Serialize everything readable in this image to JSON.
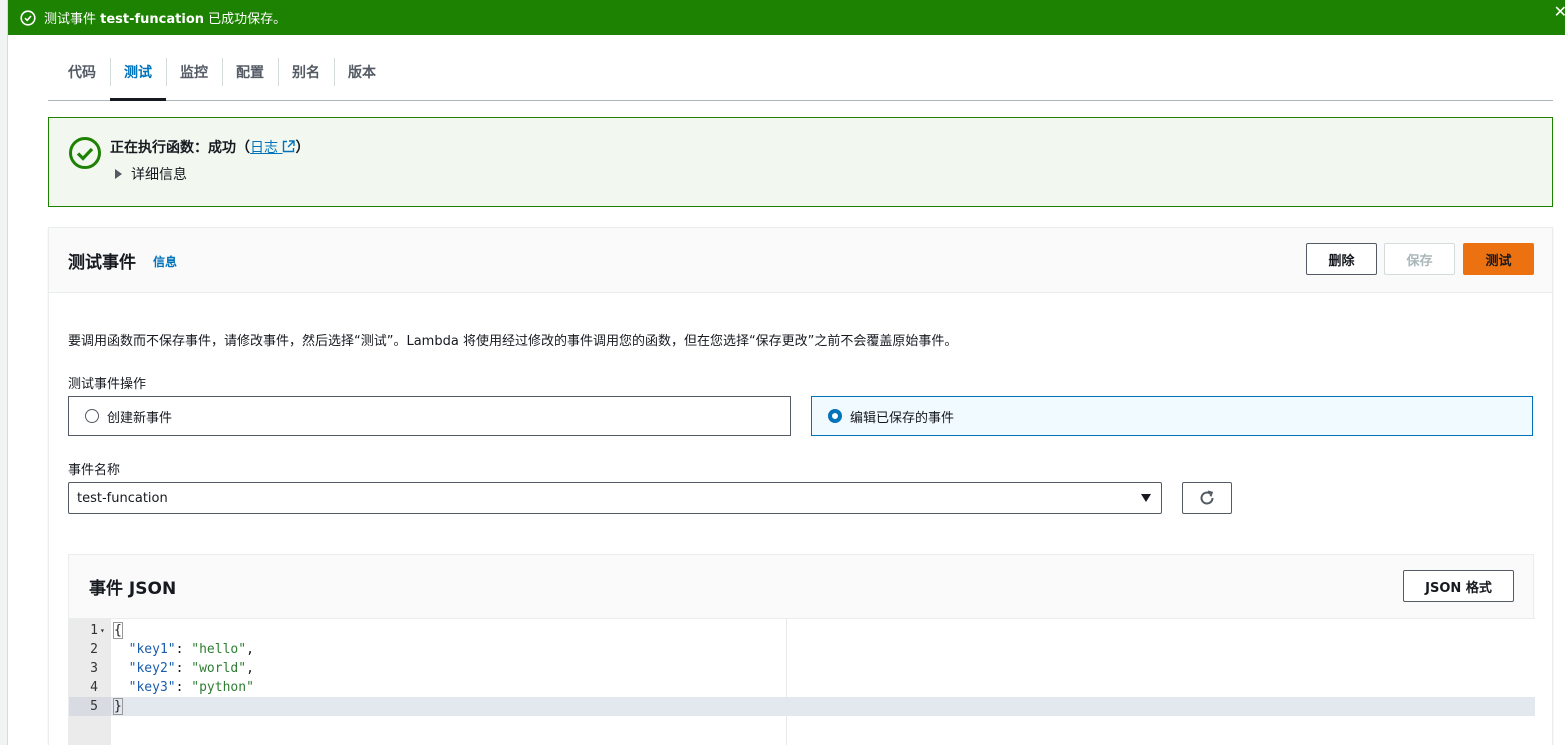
{
  "flash": {
    "prefix": "测试事件 ",
    "name": "test-funcation",
    "suffix": " 已成功保存。",
    "close_glyph": "✕"
  },
  "tabs": [
    {
      "label": "代码",
      "active": false
    },
    {
      "label": "测试",
      "active": true
    },
    {
      "label": "监控",
      "active": false
    },
    {
      "label": "配置",
      "active": false
    },
    {
      "label": "别名",
      "active": false
    },
    {
      "label": "版本",
      "active": false
    }
  ],
  "alert": {
    "status_text": "正在执行函数：成功（",
    "log_link": "日志",
    "close_paren": "）",
    "details_label": "详细信息"
  },
  "test_event": {
    "title": "测试事件",
    "info_link": "信息",
    "delete_label": "删除",
    "save_label": "保存",
    "test_label": "测试",
    "description": "要调用函数而不保存事件，请修改事件，然后选择“测试”。Lambda 将使用经过修改的事件调用您的函数，但在您选择“保存更改”之前不会覆盖原始事件。",
    "ops_label": "测试事件操作",
    "option_new": "创建新事件",
    "option_edit": "编辑已保存的事件",
    "selected_option": "编辑已保存的事件",
    "name_label": "事件名称",
    "name_value": "test-funcation"
  },
  "json_editor": {
    "title": "事件 JSON",
    "format_label": "JSON 格式",
    "current_line": 5,
    "lines": [
      {
        "n": "1",
        "text": "{"
      },
      {
        "n": "2",
        "text": "  \"key1\": \"hello\","
      },
      {
        "n": "3",
        "text": "  \"key2\": \"world\","
      },
      {
        "n": "4",
        "text": "  \"key3\": \"python\""
      },
      {
        "n": "5",
        "text": "}"
      }
    ]
  },
  "colors": {
    "success_green": "#1d8102",
    "link_blue": "#0073bb",
    "primary_orange": "#ec7211"
  },
  "icons": [
    "status-positive-icon",
    "external-link-icon",
    "caret-right-icon",
    "caret-down-icon",
    "refresh-icon",
    "close-icon"
  ]
}
